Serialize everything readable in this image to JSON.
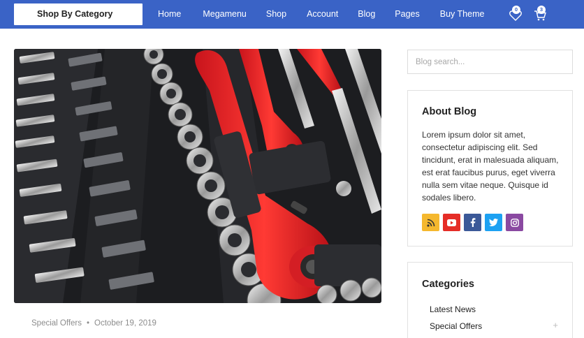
{
  "navbar": {
    "shop_by_category": "Shop By Category",
    "items": [
      {
        "label": "Home"
      },
      {
        "label": "Megamenu"
      },
      {
        "label": "Shop"
      },
      {
        "label": "Account"
      },
      {
        "label": "Blog"
      },
      {
        "label": "Pages"
      },
      {
        "label": "Buy Theme"
      }
    ],
    "wishlist_count": "0",
    "cart_count": "3",
    "bar_color": "#3a63c6"
  },
  "post": {
    "image_icon": "tool-set-image",
    "category": "Special Offers",
    "separator": "•",
    "date": "October 19, 2019"
  },
  "sidebar": {
    "search_placeholder": "Blog search...",
    "about": {
      "title": "About Blog",
      "text": "Lorem ipsum dolor sit amet, consectetur adipiscing elit. Sed tincidunt, erat in malesuada aliquam, est erat faucibus purus, eget viverra nulla sem vitae neque. Quisque id sodales libero."
    },
    "socials": [
      {
        "icon": "rss-icon",
        "color": "#f5b82e"
      },
      {
        "icon": "youtube-icon",
        "color": "#e52d27"
      },
      {
        "icon": "facebook-icon",
        "color": "#3b5998"
      },
      {
        "icon": "twitter-icon",
        "color": "#1da1f2"
      },
      {
        "icon": "instagram-icon",
        "color": "#8a49a1"
      }
    ],
    "categories": {
      "title": "Categories",
      "items": [
        {
          "label": "Latest News"
        },
        {
          "label": "Special Offers",
          "expand": "+"
        }
      ]
    }
  }
}
